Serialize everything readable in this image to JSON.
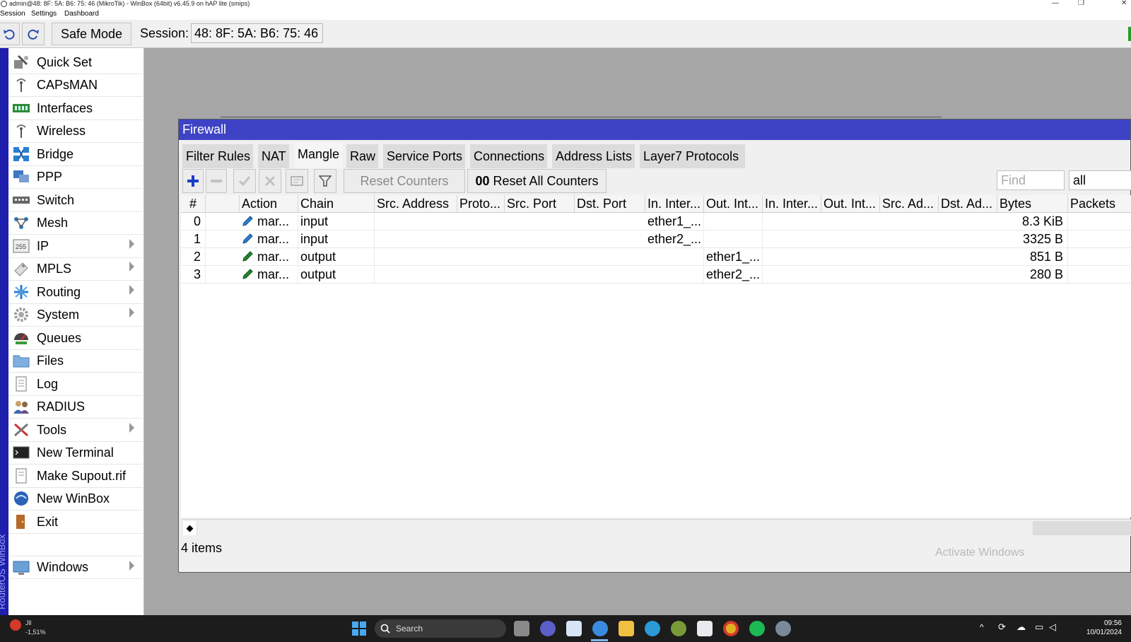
{
  "titlebar": {
    "title": "admin@48: 8F: 5A: B6: 75: 46 (MikroTik) - WinBox (64bit) v6.45.9 on hAP lite (smips)"
  },
  "menubar": {
    "items": [
      "Session",
      "Settings",
      "Dashboard"
    ]
  },
  "toolbar": {
    "safe_mode": "Safe Mode",
    "session_label": "Session:",
    "session_value": "48: 8F: 5A: B6: 75: 46"
  },
  "side_strip_label": "RouterOS WinBox",
  "sidebar": {
    "items": [
      {
        "label": "Quick Set",
        "icon": "quick-set-icon",
        "submenu": false
      },
      {
        "label": "CAPsMAN",
        "icon": "antenna-icon",
        "submenu": false
      },
      {
        "label": "Interfaces",
        "icon": "interfaces-icon",
        "submenu": false
      },
      {
        "label": "Wireless",
        "icon": "wireless-icon",
        "submenu": false
      },
      {
        "label": "Bridge",
        "icon": "bridge-icon",
        "submenu": false
      },
      {
        "label": "PPP",
        "icon": "ppp-icon",
        "submenu": false
      },
      {
        "label": "Switch",
        "icon": "switch-icon",
        "submenu": false
      },
      {
        "label": "Mesh",
        "icon": "mesh-icon",
        "submenu": false
      },
      {
        "label": "IP",
        "icon": "ip-icon",
        "submenu": true
      },
      {
        "label": "MPLS",
        "icon": "mpls-icon",
        "submenu": true
      },
      {
        "label": "Routing",
        "icon": "routing-icon",
        "submenu": true
      },
      {
        "label": "System",
        "icon": "system-gear-icon",
        "submenu": true
      },
      {
        "label": "Queues",
        "icon": "queues-icon",
        "submenu": false
      },
      {
        "label": "Files",
        "icon": "folder-icon",
        "submenu": false
      },
      {
        "label": "Log",
        "icon": "log-icon",
        "submenu": false
      },
      {
        "label": "RADIUS",
        "icon": "radius-icon",
        "submenu": false
      },
      {
        "label": "Tools",
        "icon": "tools-icon",
        "submenu": true
      },
      {
        "label": "New Terminal",
        "icon": "terminal-icon",
        "submenu": false
      },
      {
        "label": "Make Supout.rif",
        "icon": "supout-icon",
        "submenu": false
      },
      {
        "label": "New WinBox",
        "icon": "winbox-icon",
        "submenu": false
      },
      {
        "label": "Exit",
        "icon": "exit-icon",
        "submenu": false
      },
      {
        "label": "Windows",
        "icon": "windows-icon",
        "submenu": true
      }
    ]
  },
  "firewall": {
    "title": "Firewall",
    "tabs": [
      "Filter Rules",
      "NAT",
      "Mangle",
      "Raw",
      "Service Ports",
      "Connections",
      "Address Lists",
      "Layer7 Protocols"
    ],
    "active_tab": "Mangle",
    "tools": {
      "reset_counters": "Reset Counters",
      "reset_all_counters": "Reset All Counters",
      "reset_all_prefix": "00",
      "find_placeholder": "Find",
      "filter_value": "all"
    },
    "columns": [
      "#",
      "",
      "Action",
      "Chain",
      "Src. Address",
      "Proto...",
      "Src. Port",
      "Dst. Port",
      "In. Inter...",
      "Out. Int...",
      "In. Inter...",
      "Out. Int...",
      "Src. Ad...",
      "Dst. Ad...",
      "Bytes",
      "Packets"
    ],
    "rows": [
      {
        "num": "0",
        "action": "mar...",
        "chain": "input",
        "in_iface": "ether1_...",
        "out_iface": "",
        "bytes": "8.3 KiB",
        "action_color": "#2a7fd4"
      },
      {
        "num": "1",
        "action": "mar...",
        "chain": "input",
        "in_iface": "ether2_...",
        "out_iface": "",
        "bytes": "3325 B",
        "action_color": "#2a7fd4"
      },
      {
        "num": "2",
        "action": "mar...",
        "chain": "output",
        "in_iface": "",
        "out_iface": "ether1_...",
        "bytes": "851 B",
        "action_color": "#1f8a2a"
      },
      {
        "num": "3",
        "action": "mar...",
        "chain": "output",
        "in_iface": "",
        "out_iface": "ether2_...",
        "bytes": "280 B",
        "action_color": "#1f8a2a"
      }
    ],
    "status": "4 items",
    "watermark": "Activate Windows"
  },
  "taskbar": {
    "weather_temp": "-1,51%",
    "weather_extra": "Jll",
    "search_placeholder": "Search",
    "time": "09:56",
    "date": "10/01/2024",
    "accent": "#1c1c1c"
  }
}
